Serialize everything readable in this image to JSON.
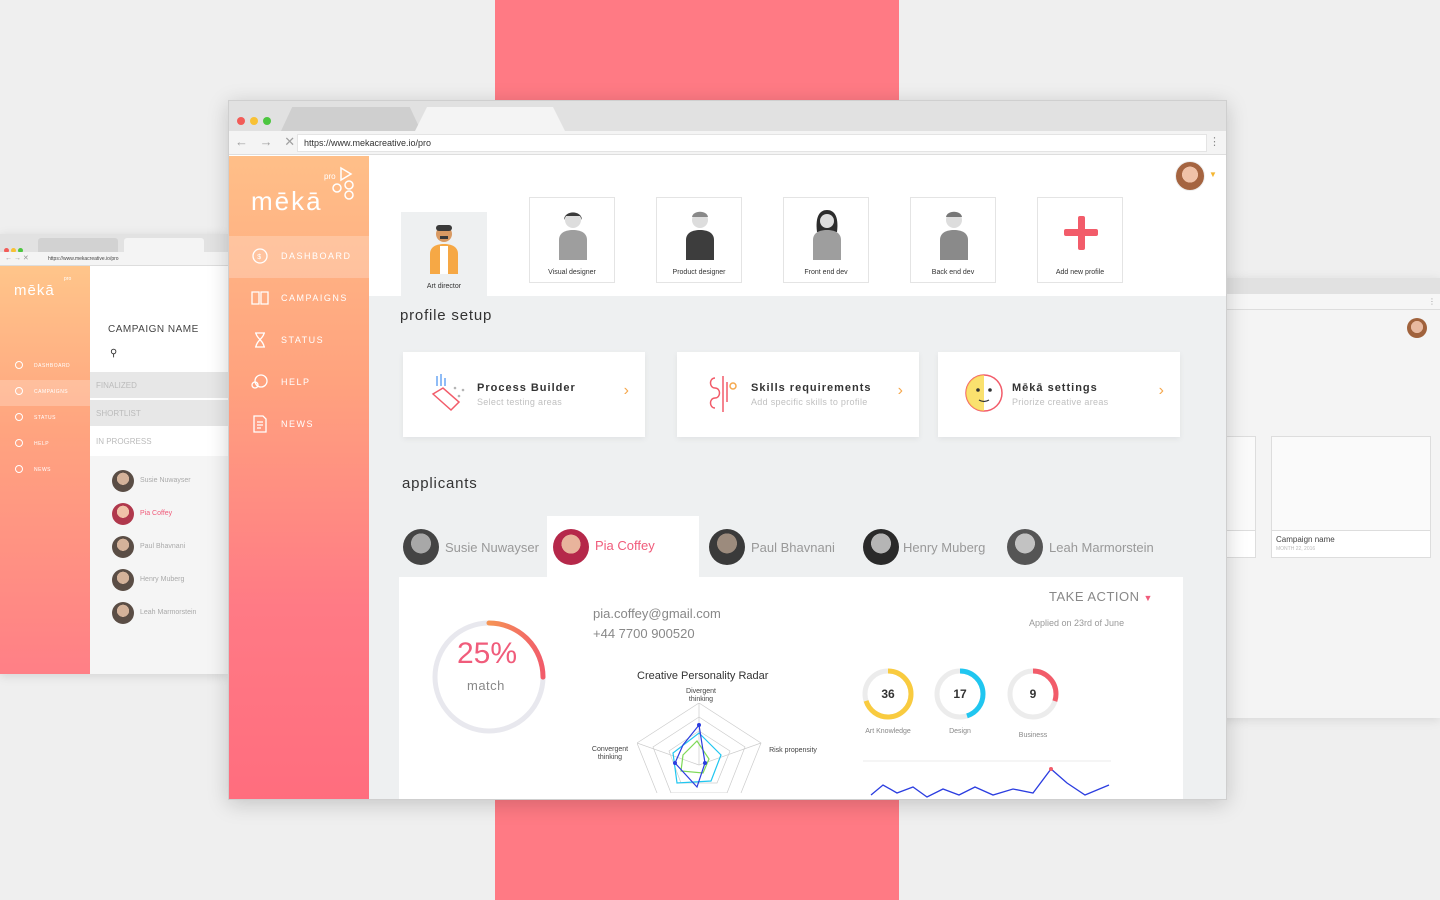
{
  "background_window_left": {
    "url": "https://www.mekacreative.io/pro",
    "logo": "mēkā",
    "logo_tag": "pro",
    "nav": [
      "DASHBOARD",
      "CAMPAIGNS",
      "STATUS",
      "HELP",
      "NEWS"
    ],
    "campaign_title": "CAMPAIGN NAME",
    "filters": [
      "FINALIZED",
      "SHORTLIST",
      "IN PROGRESS"
    ],
    "people": [
      "Susie Nuwayser",
      "Pia Coffey",
      "Paul Bhavnani",
      "Henry Muberg",
      "Leah Marmorstein"
    ]
  },
  "background_window_right": {
    "card_title": "Campaign name",
    "card_date": "MONTH 22, 2016"
  },
  "browser": {
    "url": "https://www.mekacreative.io/pro",
    "nav_glyphs": "← → ✕",
    "menu_glyph": "⋮"
  },
  "sidebar": {
    "logo": "mēkā",
    "logo_tag": "pro",
    "items": [
      {
        "label": "DASHBOARD",
        "icon": "dashboard-icon",
        "active": true
      },
      {
        "label": "CAMPAIGNS",
        "icon": "book-icon",
        "active": false
      },
      {
        "label": "STATUS",
        "icon": "hourglass-icon",
        "active": false
      },
      {
        "label": "HELP",
        "icon": "help-bubble-icon",
        "active": false
      },
      {
        "label": "NEWS",
        "icon": "news-icon",
        "active": false
      }
    ]
  },
  "profiles": [
    {
      "label": "Art director",
      "selected": true
    },
    {
      "label": "Visual designer",
      "selected": false
    },
    {
      "label": "Product designer",
      "selected": false
    },
    {
      "label": "Front end dev",
      "selected": false
    },
    {
      "label": "Back end dev",
      "selected": false
    },
    {
      "label": "Add new profile",
      "selected": false
    }
  ],
  "profile_setup": {
    "title": "profile setup",
    "cards": [
      {
        "title": "Process Builder",
        "subtitle": "Select testing areas"
      },
      {
        "title": "Skills requirements",
        "subtitle": "Add specific skills to profile"
      },
      {
        "title": "Mēkā settings",
        "subtitle": "Priorize creative areas"
      }
    ]
  },
  "applicants": {
    "title": "applicants",
    "tabs": [
      "Susie Nuwayser",
      "Pia Coffey",
      "Paul Bhavnani",
      "Henry Muberg",
      "Leah Marmorstein"
    ],
    "selected_index": 1,
    "detail": {
      "email": "pia.coffey@gmail.com",
      "phone": "+44 7700 900520",
      "take_action": "TAKE ACTION",
      "applied": "Applied on 23rd of June",
      "match_value": "25%",
      "match_fraction": 0.25,
      "match_label": "match",
      "radar_title": "Creative Personality Radar",
      "radar_axes": [
        "Divergent thinking",
        "Risk propensity",
        "Convergent thinking"
      ],
      "scores": [
        {
          "value": "36",
          "label": "Art Knowledge",
          "color": "#f9cb3f",
          "fraction": 0.7
        },
        {
          "value": "17",
          "label": "Design",
          "color": "#20c6f0",
          "fraction": 0.45
        },
        {
          "value": "9",
          "label": "Business",
          "color": "#f25c6a",
          "fraction": 0.3
        }
      ]
    }
  },
  "colors": {
    "accent": "#f05c7b",
    "brand_band": "#ff7a84",
    "orange": "#f5a84e"
  }
}
